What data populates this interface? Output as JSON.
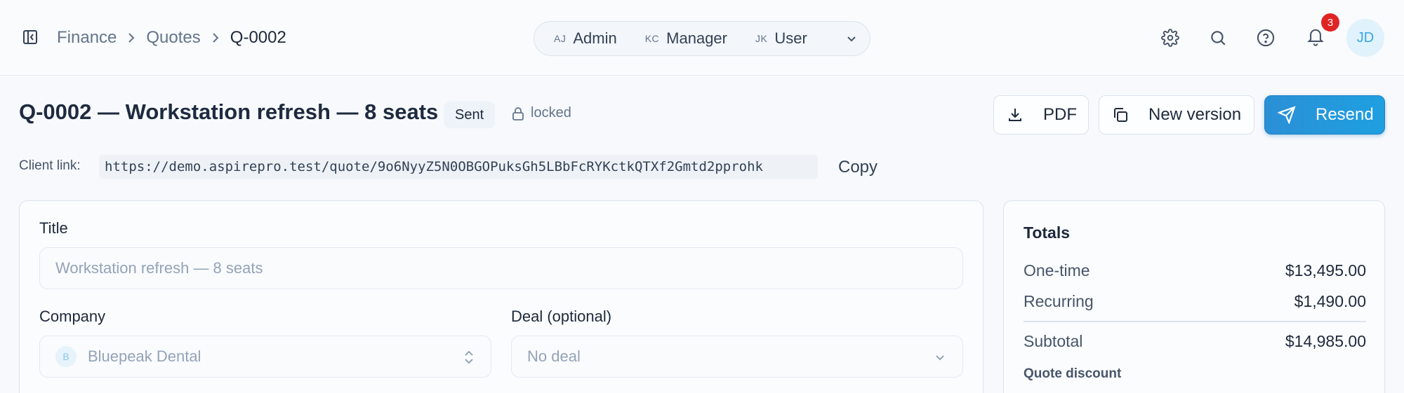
{
  "breadcrumb": {
    "items": [
      "Finance",
      "Quotes",
      "Q-0002"
    ]
  },
  "roles": [
    {
      "initials": "AJ",
      "label": "Admin"
    },
    {
      "initials": "KC",
      "label": "Manager"
    },
    {
      "initials": "JK",
      "label": "User"
    }
  ],
  "header": {
    "notifications_count": "3",
    "avatar_initials": "JD"
  },
  "quote": {
    "title": "Q-0002 — Workstation refresh — 8 seats",
    "status": "Sent",
    "lock_label": "locked"
  },
  "actions": {
    "pdf_label": "PDF",
    "new_version_label": "New version",
    "resend_label": "Resend"
  },
  "client_link": {
    "label": "Client link:",
    "url": "https://demo.aspirepro.test/quote/9o6NyyZ5N0OBGOPuksGh5LBbFcRYKctkQTXf2Gmtd2pprohk",
    "copy_label": "Copy"
  },
  "form": {
    "title_label": "Title",
    "title_value": "Workstation refresh — 8 seats",
    "company_label": "Company",
    "company_initial": "B",
    "company_value": "Bluepeak Dental",
    "deal_label": "Deal (optional)",
    "deal_value": "No deal"
  },
  "totals": {
    "heading": "Totals",
    "one_time_label": "One-time",
    "one_time_value": "$13,495.00",
    "recurring_label": "Recurring",
    "recurring_value": "$1,490.00",
    "subtotal_label": "Subtotal",
    "subtotal_value": "$14,985.00",
    "discount_label": "Quote discount"
  },
  "colors": {
    "accent": "#1ea0e0",
    "badge": "#e02424",
    "text": "#1e2a3f"
  }
}
